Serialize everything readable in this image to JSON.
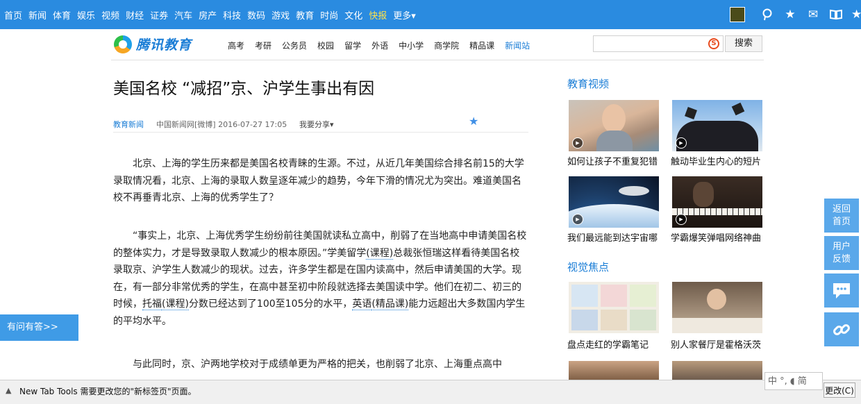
{
  "top_nav": [
    "首页",
    "新闻",
    "体育",
    "娱乐",
    "视频",
    "财经",
    "证券",
    "汽车",
    "房产",
    "科技",
    "数码",
    "游戏",
    "教育",
    "时尚",
    "文化",
    "快报",
    "更多▾"
  ],
  "top_nav_highlight": "快报",
  "logo_text": "腾讯教育",
  "sub_nav": [
    "高考",
    "考研",
    "公务员",
    "校园",
    "留学",
    "外语",
    "中小学",
    "商学院",
    "精品课",
    "新闻站"
  ],
  "sub_nav_active": "新闻站",
  "search": {
    "value": "",
    "button": "搜索"
  },
  "article": {
    "title": "美国名校 “减招”京、沪学生事出有因",
    "category": "教育新闻",
    "source": "中国新闻网[微博] 2016-07-27 17:05",
    "share": "我要分享▾",
    "p1": "北京、上海的学生历来都是美国名校青睐的生源。不过，从近几年美国综合排名前15的大学录取情况看，北京、上海的录取人数呈逐年减少的趋势，今年下滑的情况尤为突出。难道美国名校不再垂青北京、上海的优秀学生了？",
    "p2a": "“事实上，北京、上海优秀学生纷纷前往美国就读私立高中，削弱了在当地高中申请美国名校的整体实力，才是导致录取人数减少的根本原因。”学美留学",
    "p2_link1": "(课程)",
    "p2b": "总裁张恒瑞这样看待美国名校录取京、沪学生人数减少的现状。过去，许多学生都是在国内读高中，然后申请美国的大学。现在，有一部分非常优秀的学生，在高中甚至初中阶段就选择去美国读中学。他们在初二、初三的时候，",
    "p2_link2": "托福",
    "p2_link3": "(课程)",
    "p2c": "分数已经达到了100至105分的水平，",
    "p2_link4": "英语",
    "p2_link5": "(精品课)",
    "p2d": "能力远超出大多数国内学生的平均水平。",
    "p3": "与此同时，京、沪两地学校对于成绩单更为严格的把关，也削弱了北京、上海重点高中"
  },
  "sidebar": {
    "video_title": "教育视频",
    "videos": [
      {
        "caption": "如何让孩子不重复犯错"
      },
      {
        "caption": "触动毕业生内心的短片"
      },
      {
        "caption": "我们最远能到达宇宙哪"
      },
      {
        "caption": "学霸爆笑弹唱网络神曲"
      }
    ],
    "focus_title": "视觉焦点",
    "focus": [
      {
        "caption": "盘点走红的学霸笔记"
      },
      {
        "caption": "别人家餐厅是霍格沃茨"
      }
    ]
  },
  "float_buttons": {
    "back": "返回首页",
    "feedback": "用户反馈"
  },
  "qa_label": "有问有答>>",
  "status_bar": {
    "message": "New Tab Tools 需要更改您的\"新标签页\"页面。",
    "button": "更改(C)"
  },
  "ime": "中 °, ◖ 简"
}
